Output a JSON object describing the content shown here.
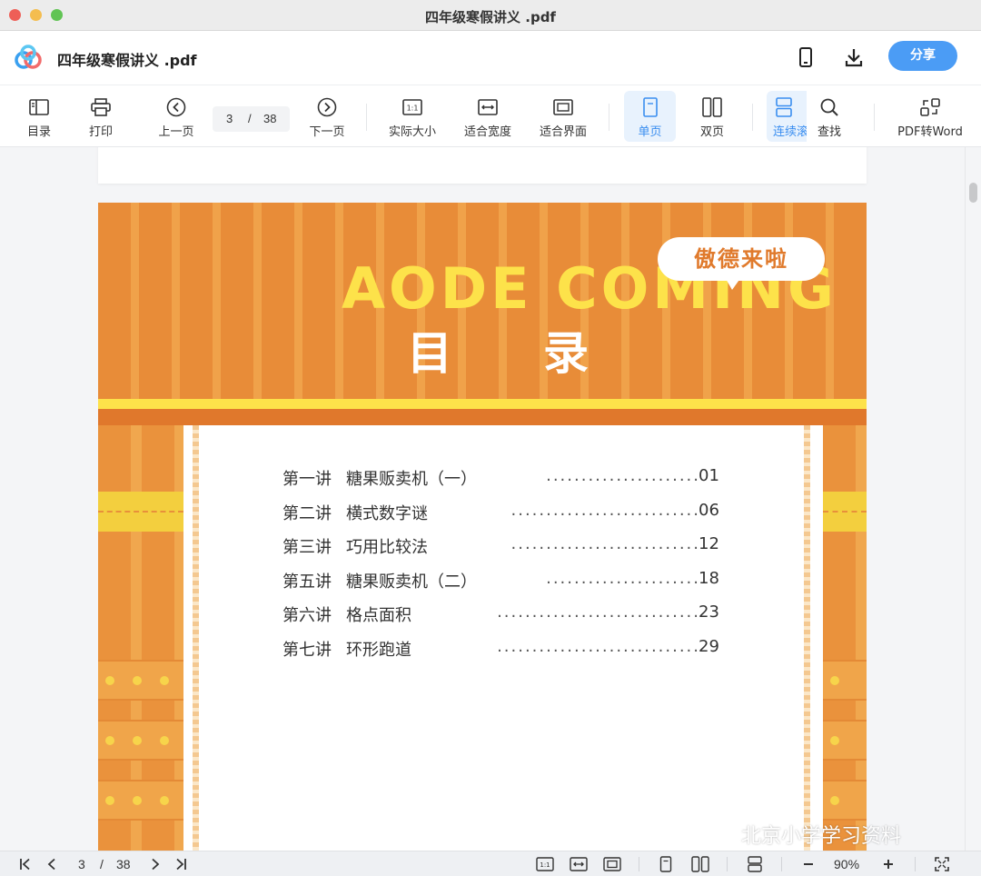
{
  "window": {
    "title": "四年级寒假讲义 .pdf"
  },
  "header": {
    "file_name": "四年级寒假讲义 .pdf",
    "share_label": "分享"
  },
  "toolbar": {
    "toc": "目录",
    "print": "打印",
    "prev": "上一页",
    "current_page": "3",
    "separator": "/",
    "total_pages": "38",
    "next": "下一页",
    "actual_size": "实际大小",
    "fit_width": "适合宽度",
    "fit_page": "适合界面",
    "single_page": "单页",
    "double_page": "双页",
    "continuous": "连续滚",
    "find": "查找",
    "pdf_to_word": "PDF转Word"
  },
  "document": {
    "banner_en": "AODE COMING",
    "banner_cn": "目录",
    "badge": "傲德来啦",
    "toc": [
      {
        "lesson": "第一讲",
        "title": "糖果贩卖机（一）",
        "leader": "......................",
        "page": "01"
      },
      {
        "lesson": "第二讲",
        "title": "横式数字谜",
        "leader": "...........................",
        "page": "06"
      },
      {
        "lesson": "第三讲",
        "title": "巧用比较法",
        "leader": "...........................",
        "page": "12"
      },
      {
        "lesson": "第五讲",
        "title": "糖果贩卖机（二）",
        "leader": "......................",
        "page": "18"
      },
      {
        "lesson": "第六讲",
        "title": "格点面积",
        "leader": ".............................",
        "page": "23"
      },
      {
        "lesson": "第七讲",
        "title": "环形跑道",
        "leader": ".............................",
        "page": "29"
      }
    ],
    "watermark": "北京小学学习资料"
  },
  "statusbar": {
    "current_page": "3",
    "separator": "/",
    "total_pages": "38",
    "zoom": "90%"
  },
  "colors": {
    "accent": "#4b9cf5",
    "banner_orange": "#e88c38",
    "banner_yellow": "#fde24a"
  }
}
